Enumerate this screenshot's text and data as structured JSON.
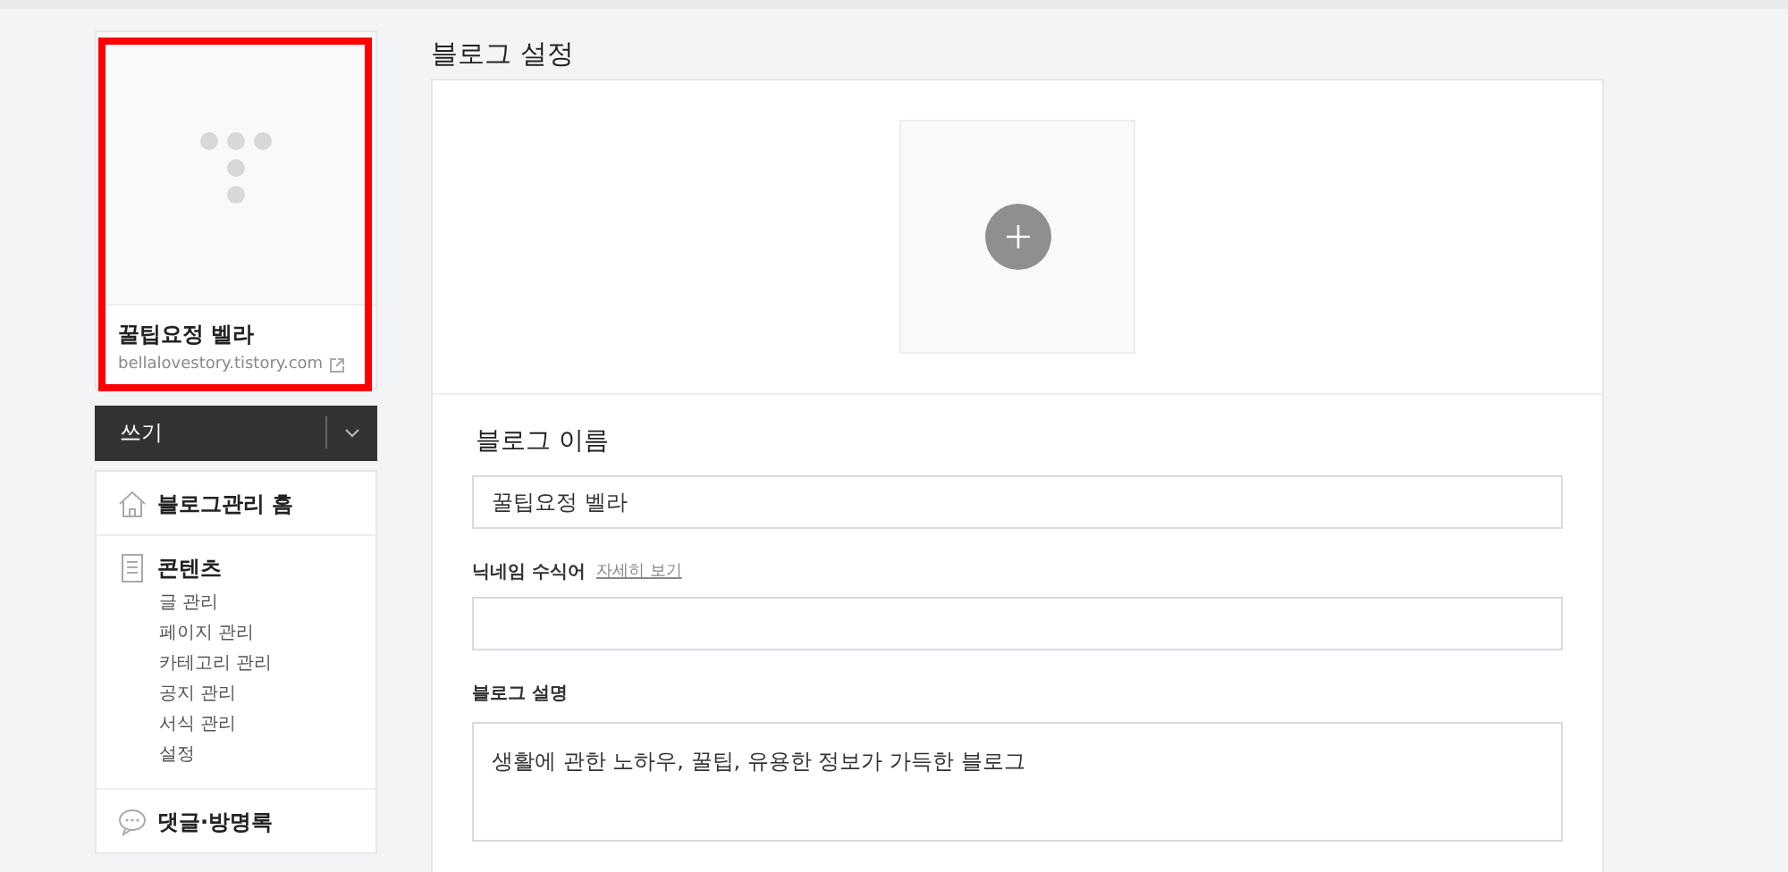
{
  "profile": {
    "name": "꿀팁요정 벨라",
    "url": "bellalovestory.tistory.com",
    "highlighted": true
  },
  "write_button": {
    "label": "쓰기"
  },
  "menu": [
    {
      "kind": "home",
      "label": "블로그관리 홈"
    },
    {
      "kind": "content",
      "label": "콘텐츠",
      "children": [
        {
          "label": "글 관리"
        },
        {
          "label": "페이지 관리"
        },
        {
          "label": "카테고리 관리"
        },
        {
          "label": "공지 관리"
        },
        {
          "label": "서식 관리"
        },
        {
          "label": "설정"
        }
      ]
    },
    {
      "kind": "comment",
      "label": "댓글·방명록"
    }
  ],
  "page_title": "블로그 설정",
  "form": {
    "name_label": "블로그 이름",
    "name_value": "꿀팁요정 벨라",
    "nickname_label": "닉네임 수식어",
    "nickname_link": "자세히 보기",
    "description_label": "블로그 설명",
    "description_value": "생활에 관한 노하우, 꿀팁, 유용한 정보가 가득한 블로그"
  }
}
